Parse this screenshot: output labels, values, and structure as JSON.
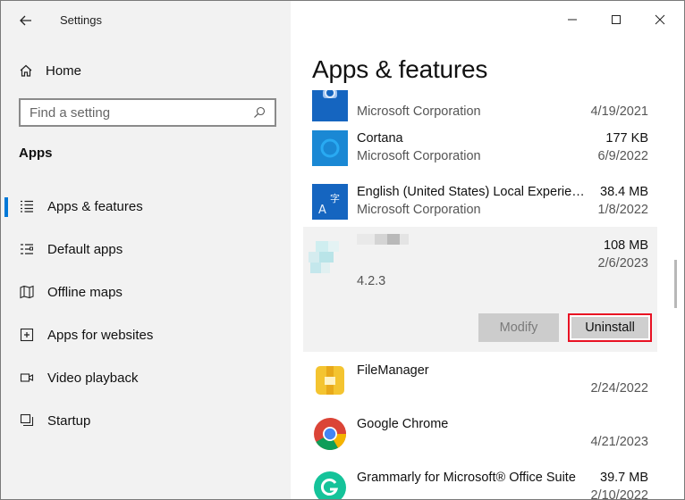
{
  "window": {
    "title": "Settings"
  },
  "sidebar": {
    "home_label": "Home",
    "search_placeholder": "Find a setting",
    "section_title": "Apps",
    "items": [
      {
        "label": "Apps & features",
        "icon": "apps-features-icon",
        "active": true
      },
      {
        "label": "Default apps",
        "icon": "default-apps-icon",
        "active": false
      },
      {
        "label": "Offline maps",
        "icon": "offline-maps-icon",
        "active": false
      },
      {
        "label": "Apps for websites",
        "icon": "apps-websites-icon",
        "active": false
      },
      {
        "label": "Video playback",
        "icon": "video-playback-icon",
        "active": false
      },
      {
        "label": "Startup",
        "icon": "startup-icon",
        "active": false
      }
    ]
  },
  "main": {
    "title": "Apps & features",
    "apps": [
      {
        "name": "",
        "publisher": "Microsoft Corporation",
        "size": "",
        "date": "4/19/2021",
        "icon": "camera-app-icon"
      },
      {
        "name": "Cortana",
        "publisher": "Microsoft Corporation",
        "size": "177 KB",
        "date": "6/9/2022",
        "icon": "cortana-icon"
      },
      {
        "name": "English (United States) Local Experience Pack",
        "publisher": "Microsoft Corporation",
        "size": "38.4 MB",
        "date": "1/8/2022",
        "icon": "language-pack-icon"
      },
      {
        "name": "FileManager",
        "publisher": "",
        "size": "",
        "date": "2/24/2022",
        "icon": "file-manager-icon"
      },
      {
        "name": "Google Chrome",
        "publisher": "",
        "size": "",
        "date": "4/21/2023",
        "icon": "chrome-icon"
      },
      {
        "name": "Grammarly for Microsoft® Office Suite",
        "publisher": "",
        "size": "39.7 MB",
        "date": "2/10/2022",
        "icon": "grammarly-icon"
      }
    ],
    "selected_app": {
      "size": "108 MB",
      "date": "2/6/2023",
      "version": "4.2.3",
      "modify_label": "Modify",
      "uninstall_label": "Uninstall"
    }
  },
  "colors": {
    "accent": "#0078d7",
    "highlight_border": "#e81123",
    "sidebar_bg": "#f2f2f2"
  }
}
